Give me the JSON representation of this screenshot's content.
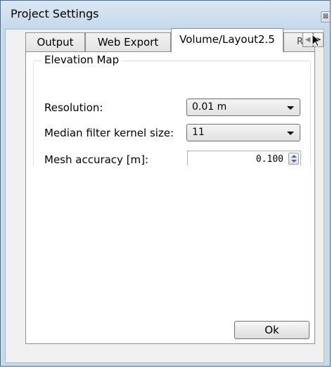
{
  "window": {
    "title": "Project Settings",
    "close_glyph": "⊠"
  },
  "tabs": [
    {
      "label": "Output",
      "active": false
    },
    {
      "label": "Web Export",
      "active": false
    },
    {
      "label": "Volume/Layout2.5",
      "active": true
    },
    {
      "label": "Regis",
      "active": false
    }
  ],
  "tab_scroll": {
    "left_glyph": "◀",
    "right_glyph": "▶"
  },
  "elevation_map": {
    "title": "Elevation Map",
    "resolution": {
      "label": "Resolution:",
      "value": "0.01 m"
    },
    "median_filter": {
      "label": "Median filter kernel size:",
      "value": "11"
    },
    "mesh_accuracy": {
      "label": "Mesh accuracy [m]:",
      "value": "0.100"
    }
  },
  "buttons": {
    "ok_label": "Ok"
  },
  "colors": {
    "title_bar": "#c6d9ea",
    "window_border": "#4a6b8a",
    "spin_arrow": "#3f6aa7"
  }
}
